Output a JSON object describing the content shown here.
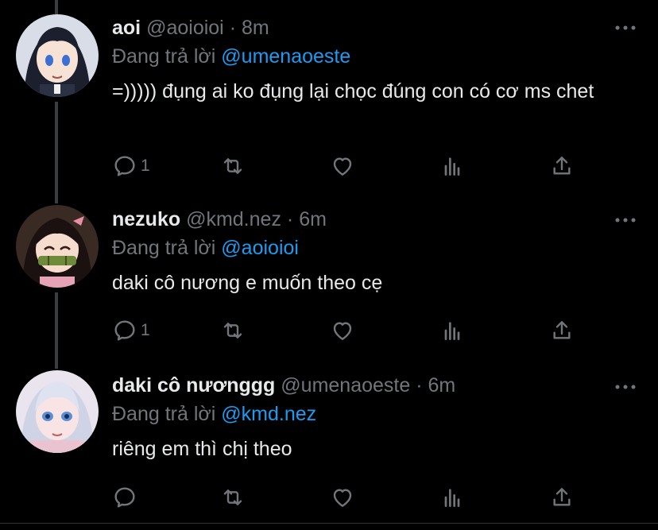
{
  "tweets": [
    {
      "name": "aoi",
      "handle": "@aoioioi",
      "separator": "·",
      "time": "8m",
      "reply_prefix": "Đang trả lời",
      "reply_to": "@umenaoeste",
      "text": "=))))) đụng ai ko đụng lại chọc đúng con có cơ ms chet",
      "reply_count": "1",
      "avatar_icon": "aoi-anime-avatar"
    },
    {
      "name": "nezuko",
      "handle": "@kmd.nez",
      "separator": "·",
      "time": "6m",
      "reply_prefix": "Đang trả lời",
      "reply_to": "@aoioioi",
      "text": "daki cô nương e muốn theo cẹ",
      "reply_count": "1",
      "avatar_icon": "nezuko-anime-avatar"
    },
    {
      "name": "daki cô nươnggg",
      "handle": "@umenaoeste",
      "separator": "·",
      "time": "6m",
      "reply_prefix": "Đang trả lời",
      "reply_to": "@kmd.nez",
      "text": "riêng em thì chị theo",
      "reply_count": "",
      "avatar_icon": "daki-anime-avatar"
    }
  ],
  "colors": {
    "background": "#000000",
    "text": "#e7e9ea",
    "muted": "#71767b",
    "accent": "#1d9bf0",
    "thread_line": "#3a3d40"
  }
}
